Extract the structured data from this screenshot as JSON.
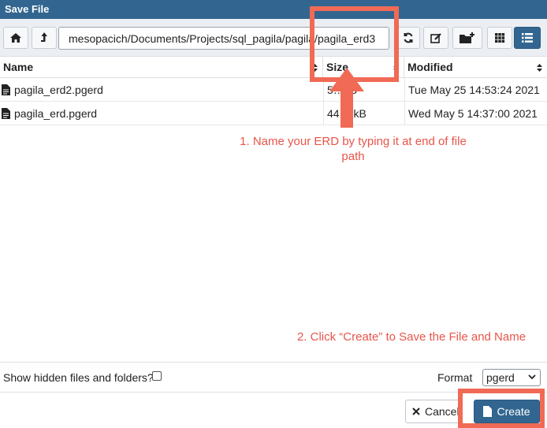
{
  "dialog": {
    "title": "Save File"
  },
  "toolbar": {
    "path_value": "mesopacich/Documents/Projects/sql_pagila/pagila/pagila_erd3"
  },
  "table": {
    "columns": [
      "Name",
      "Size",
      "Modified"
    ],
    "rows": [
      {
        "name": "pagila_erd2.pgerd",
        "size": "5…kB",
        "modified": "Tue May 25 14:53:24 2021"
      },
      {
        "name": "pagila_erd.pgerd",
        "size": "44.…kB",
        "modified": "Wed May 5 14:37:00 2021"
      }
    ]
  },
  "annotations": {
    "step1": "1. Name your ERD by typing it at end of file path",
    "step2": "2. Click “Create” to Save the File and Name"
  },
  "footer": {
    "show_hidden_label": "Show hidden files and folders?",
    "show_hidden_checked": false,
    "format_label": "Format",
    "format_value": "pgerd",
    "cancel_label": "Cancel",
    "create_label": "Create"
  },
  "colors": {
    "accent": "#326690",
    "annotation": "#e8554a",
    "highlight": "#f06a55"
  }
}
